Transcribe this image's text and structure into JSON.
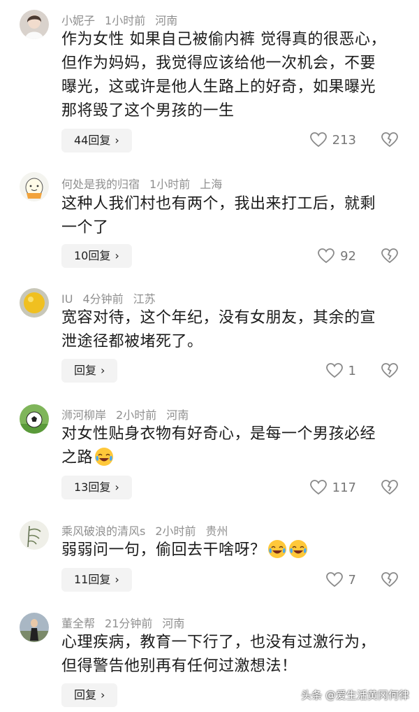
{
  "comments": [
    {
      "username": "小妮子",
      "time": "1小时前",
      "location": "河南",
      "lines": [
        "作为女性 如果自己被偷内裤 觉得真的很恶心，",
        "但作为妈妈，我觉得应该给他一次机会，不要",
        "曝光，这或许是他人生路上的好奇，如果曝光",
        "那将毁了这个男孩的一生"
      ],
      "reply_label": "44回复",
      "likes": "213"
    },
    {
      "username": "何处是我的归宿",
      "time": "1小时前",
      "location": "上海",
      "lines": [
        "这种人我们村也有两个，我出来打工后，就剩",
        "一个了"
      ],
      "reply_label": "10回复",
      "likes": "92"
    },
    {
      "username": "IU",
      "time": "4分钟前",
      "location": "江苏",
      "lines": [
        "宽容对待，这个年纪，没有女朋友，其余的宣",
        "泄途径都被堵死了。"
      ],
      "reply_label": "回复",
      "likes": "1"
    },
    {
      "username": "浉河柳岸",
      "time": "2小时前",
      "location": "河南",
      "lines": [
        "对女性贴身衣物有好奇心，是每一个男孩必经",
        "之路"
      ],
      "reply_label": "13回复",
      "likes": "117"
    },
    {
      "username": "乘风破浪的清风s",
      "time": "2小时前",
      "location": "贵州",
      "lines": [
        "弱弱问一句，偷回去干啥呀？"
      ],
      "reply_label": "11回复",
      "likes": "7"
    },
    {
      "username": "董全帮",
      "time": "21分钟前",
      "location": "河南",
      "lines": [
        "心理疾病，教育一下行了，也没有过激行为，",
        "但得警告他别再有任何过激想法！"
      ],
      "reply_label": "回复",
      "likes": ""
    }
  ],
  "watermark": "头条 @爱生活黄冈何律",
  "colors": {
    "text": "#1b1b1b",
    "meta": "#8f8f8f",
    "reply_bg": "#f3f3f3",
    "icon": "#8a8a8a"
  }
}
